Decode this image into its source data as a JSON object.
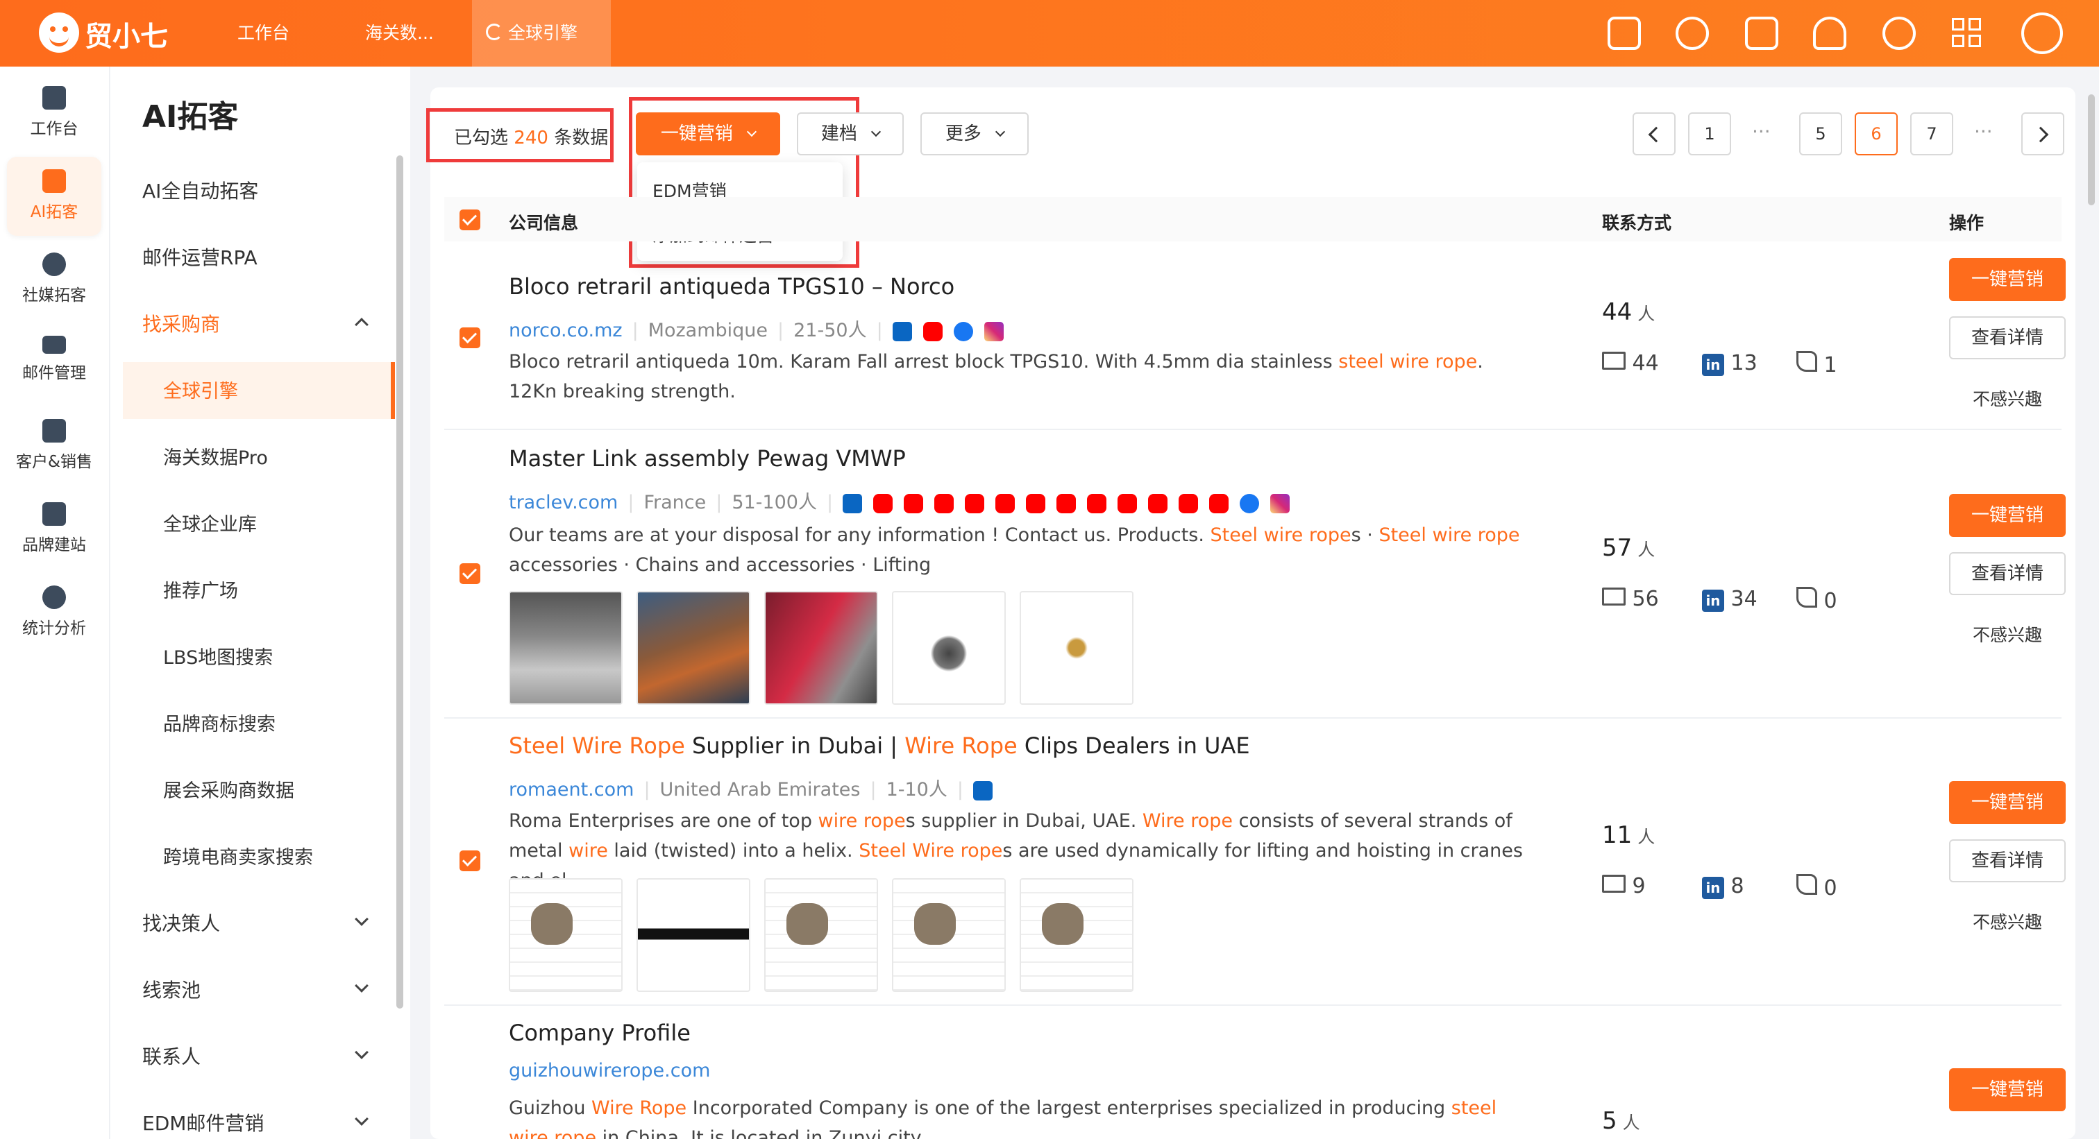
{
  "app": {
    "name": "贸小七"
  },
  "topbar": {
    "tabs": [
      {
        "label": "工作台"
      },
      {
        "label": "海关数..."
      },
      {
        "label": "全球引擎"
      }
    ]
  },
  "rail": {
    "items": [
      {
        "label": "工作台"
      },
      {
        "label": "AI拓客"
      },
      {
        "label": "社媒拓客"
      },
      {
        "label": "邮件管理"
      },
      {
        "label": "客户&销售"
      },
      {
        "label": "品牌建站"
      },
      {
        "label": "统计分析"
      }
    ]
  },
  "submenu": {
    "title": "AI拓客",
    "items": [
      {
        "label": "AI全自动拓客"
      },
      {
        "label": "邮件运营RPA"
      },
      {
        "label": "找采购商"
      }
    ],
    "children": [
      {
        "label": "全球引擎"
      },
      {
        "label": "海关数据Pro"
      },
      {
        "label": "全球企业库"
      },
      {
        "label": "推荐广场"
      },
      {
        "label": "LBS地图搜索"
      },
      {
        "label": "品牌商标搜索"
      },
      {
        "label": "展会采购商数据"
      },
      {
        "label": "跨境电商卖家搜索"
      }
    ],
    "more": [
      {
        "label": "找决策人"
      },
      {
        "label": "线索池"
      },
      {
        "label": "联系人"
      },
      {
        "label": "EDM邮件营销"
      }
    ]
  },
  "toolbar": {
    "selected_prefix": "已勾选",
    "selected_count": "240",
    "selected_suffix": "条数据",
    "marketing_label": "一键营销",
    "archive_label": "建档",
    "more_label": "更多",
    "dropdown": [
      "EDM营销",
      "添加到邮件运营RPA"
    ]
  },
  "pagination": {
    "pages": [
      "1",
      "5",
      "6",
      "7"
    ],
    "dots": "···",
    "current": "6"
  },
  "table": {
    "headers": {
      "company": "公司信息",
      "contact": "联系方式",
      "action": "操作"
    }
  },
  "actions": {
    "primary": "一键营销",
    "detail": "查看详情",
    "dislike": "不感兴趣"
  },
  "results": [
    {
      "name": "Bloco retraril antiqueda TPGS10 – Norco",
      "domain": "norco.co.mz",
      "country": "Mozambique",
      "size": "21-50人",
      "desc_pre": "Bloco retraril antiqueda 10m. Karam Fall arrest block TPGS10. With 4.5mm dia stainless ",
      "desc_hl": "steel wire rope",
      "desc_post": ". 12Kn breaking strength.",
      "people": "44",
      "people_unit": "人",
      "email": "44",
      "linkedin": "13",
      "phone": "1"
    },
    {
      "name": "Master Link assembly Pewag VMWP",
      "domain": "traclev.com",
      "country": "France",
      "size": "51-100人",
      "desc_a": "Our teams are at your disposal for any information ! Contact us. Products. ",
      "desc_hl1": "Steel wire rope",
      "desc_b": "s · ",
      "desc_hl2": "Steel wire rope",
      "desc_c": " accessories · Chains and accessories · Lifting",
      "people": "57",
      "people_unit": "人",
      "email": "56",
      "linkedin": "34",
      "phone": "0"
    },
    {
      "name_hl1": "Steel Wire Rope",
      "name_a": " Supplier in Dubai | ",
      "name_hl2": "Wire Rope",
      "name_b": " Clips Dealers in UAE",
      "domain": "romaent.com",
      "country": "United Arab Emirates",
      "size": "1-10人",
      "desc_a": "Roma Enterprises are one of top ",
      "desc_hl1": "wire rope",
      "desc_b": "s supplier in Dubai, UAE. ",
      "desc_hl2": "Wire rope",
      "desc_c": " consists of several strands of metal ",
      "desc_hl3": "wire",
      "desc_d": " laid (twisted) into a helix. ",
      "desc_hl4": "Steel Wire rope",
      "desc_e": "s are used dynamically for lifting and hoisting in cranes and el...",
      "people": "11",
      "people_unit": "人",
      "email": "9",
      "linkedin": "8",
      "phone": "0"
    },
    {
      "name": "Company Profile",
      "domain": "guizhouwirerope.com",
      "desc_a": "Guizhou ",
      "desc_hl1": "Wire Rope",
      "desc_b": " Incorporated Company is one of the largest enterprises specialized in producing ",
      "desc_hl2": "steel wire rope",
      "desc_c": " in China. It is located in Zunyi city",
      "people": "5",
      "people_unit": "人"
    }
  ],
  "colors": {
    "brand": "#fe6c1c",
    "highlight_box": "#ef3b3b",
    "link": "#3b87d8"
  }
}
